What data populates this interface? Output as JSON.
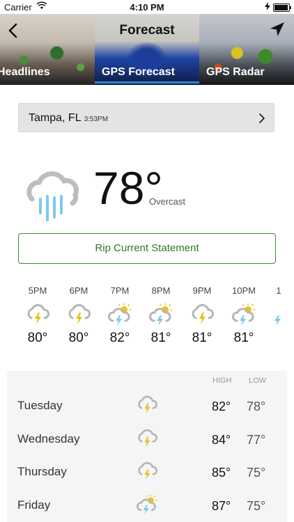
{
  "status": {
    "carrier": "Carrier",
    "time": "4:10 PM",
    "battery_fraction": 0.95
  },
  "header": {
    "title": "Forecast"
  },
  "tabs": [
    {
      "label": "Headlines"
    },
    {
      "label": "GPS Forecast",
      "selected": true
    },
    {
      "label": "GPS Radar"
    }
  ],
  "location": {
    "city": "Tampa, FL",
    "time": "3:53PM"
  },
  "current": {
    "temp": "78°",
    "condition": "Overcast",
    "icon": "rain-cloud-icon"
  },
  "alert": {
    "label": "Rip Current Statement"
  },
  "hourly": [
    {
      "time": "5PM",
      "temp": "80°",
      "icon": "thunder-cloud-icon"
    },
    {
      "time": "6PM",
      "temp": "80°",
      "icon": "thunder-cloud-icon"
    },
    {
      "time": "7PM",
      "temp": "82°",
      "icon": "sun-thunder-icon"
    },
    {
      "time": "8PM",
      "temp": "81°",
      "icon": "sun-thunder-icon"
    },
    {
      "time": "9PM",
      "temp": "81°",
      "icon": "thunder-cloud-icon"
    },
    {
      "time": "10PM",
      "temp": "81°",
      "icon": "sun-thunder-icon"
    },
    {
      "time": "1",
      "temp": "",
      "icon": "sun-thunder-icon"
    }
  ],
  "daily": {
    "high_label": "HIGH",
    "low_label": "LOW",
    "days": [
      {
        "name": "Tuesday",
        "high": "82°",
        "low": "78°",
        "icon": "thunder-cloud-icon"
      },
      {
        "name": "Wednesday",
        "high": "84°",
        "low": "77°",
        "icon": "thunder-cloud-icon"
      },
      {
        "name": "Thursday",
        "high": "85°",
        "low": "75°",
        "icon": "thunder-cloud-icon"
      },
      {
        "name": "Friday",
        "high": "87°",
        "low": "75°",
        "icon": "sun-thunder-icon"
      }
    ]
  },
  "colors": {
    "accent": "#2d86d9",
    "alert": "#2f7a23",
    "rain": "#7fc8ef",
    "bolt": "#e6c21a",
    "sun": "#f2c21b"
  }
}
